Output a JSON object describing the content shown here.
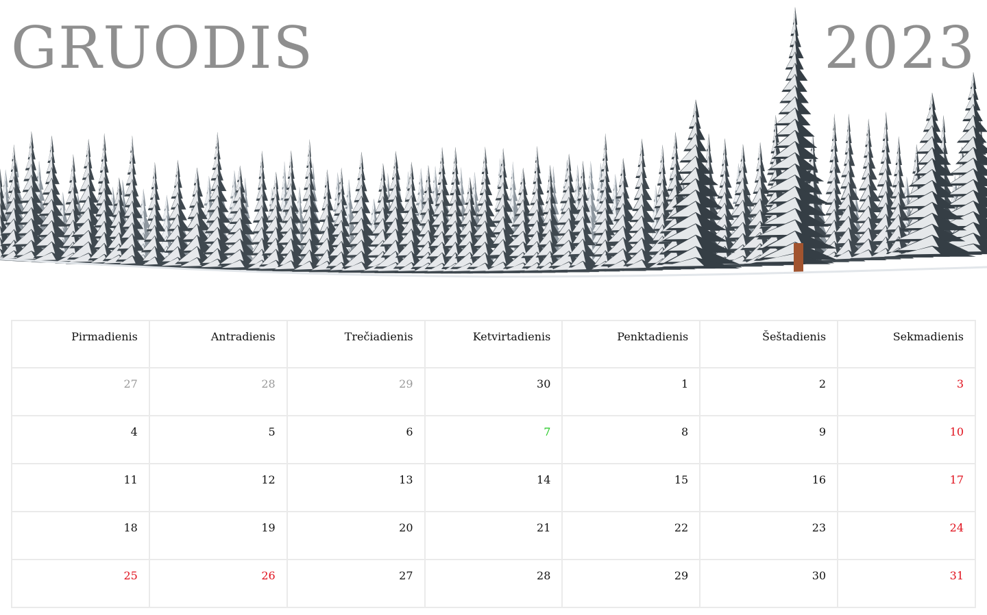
{
  "header": {
    "month": "GRUODIS",
    "year": "2023"
  },
  "hero_image": {
    "subject": "snow-covered pine forest"
  },
  "colors": {
    "title": "#8f8f8f",
    "day_text": "#111111",
    "adjacent_month_day": "#999999",
    "holiday_day": "#e0101c",
    "today": "#1ec81e",
    "grid_line": "#eaeaea"
  },
  "calendar": {
    "weekdays": [
      "Pirmadienis",
      "Antradienis",
      "Trečiadienis",
      "Ketvirtadienis",
      "Penktadienis",
      "Šeštadienis",
      "Sekmadienis"
    ],
    "weeks": [
      [
        {
          "day": "27",
          "status": "other-month"
        },
        {
          "day": "28",
          "status": "other-month"
        },
        {
          "day": "29",
          "status": "other-month"
        },
        {
          "day": "30",
          "status": "normal"
        },
        {
          "day": "1",
          "status": "normal"
        },
        {
          "day": "2",
          "status": "normal"
        },
        {
          "day": "3",
          "status": "holiday"
        }
      ],
      [
        {
          "day": "4",
          "status": "normal"
        },
        {
          "day": "5",
          "status": "normal"
        },
        {
          "day": "6",
          "status": "normal"
        },
        {
          "day": "7",
          "status": "today"
        },
        {
          "day": "8",
          "status": "normal"
        },
        {
          "day": "9",
          "status": "normal"
        },
        {
          "day": "10",
          "status": "holiday"
        }
      ],
      [
        {
          "day": "11",
          "status": "normal"
        },
        {
          "day": "12",
          "status": "normal"
        },
        {
          "day": "13",
          "status": "normal"
        },
        {
          "day": "14",
          "status": "normal"
        },
        {
          "day": "15",
          "status": "normal"
        },
        {
          "day": "16",
          "status": "normal"
        },
        {
          "day": "17",
          "status": "holiday"
        }
      ],
      [
        {
          "day": "18",
          "status": "normal"
        },
        {
          "day": "19",
          "status": "normal"
        },
        {
          "day": "20",
          "status": "normal"
        },
        {
          "day": "21",
          "status": "normal"
        },
        {
          "day": "22",
          "status": "normal"
        },
        {
          "day": "23",
          "status": "normal"
        },
        {
          "day": "24",
          "status": "holiday"
        }
      ],
      [
        {
          "day": "25",
          "status": "holiday"
        },
        {
          "day": "26",
          "status": "holiday"
        },
        {
          "day": "27",
          "status": "normal"
        },
        {
          "day": "28",
          "status": "normal"
        },
        {
          "day": "29",
          "status": "normal"
        },
        {
          "day": "30",
          "status": "normal"
        },
        {
          "day": "31",
          "status": "holiday"
        }
      ]
    ]
  }
}
